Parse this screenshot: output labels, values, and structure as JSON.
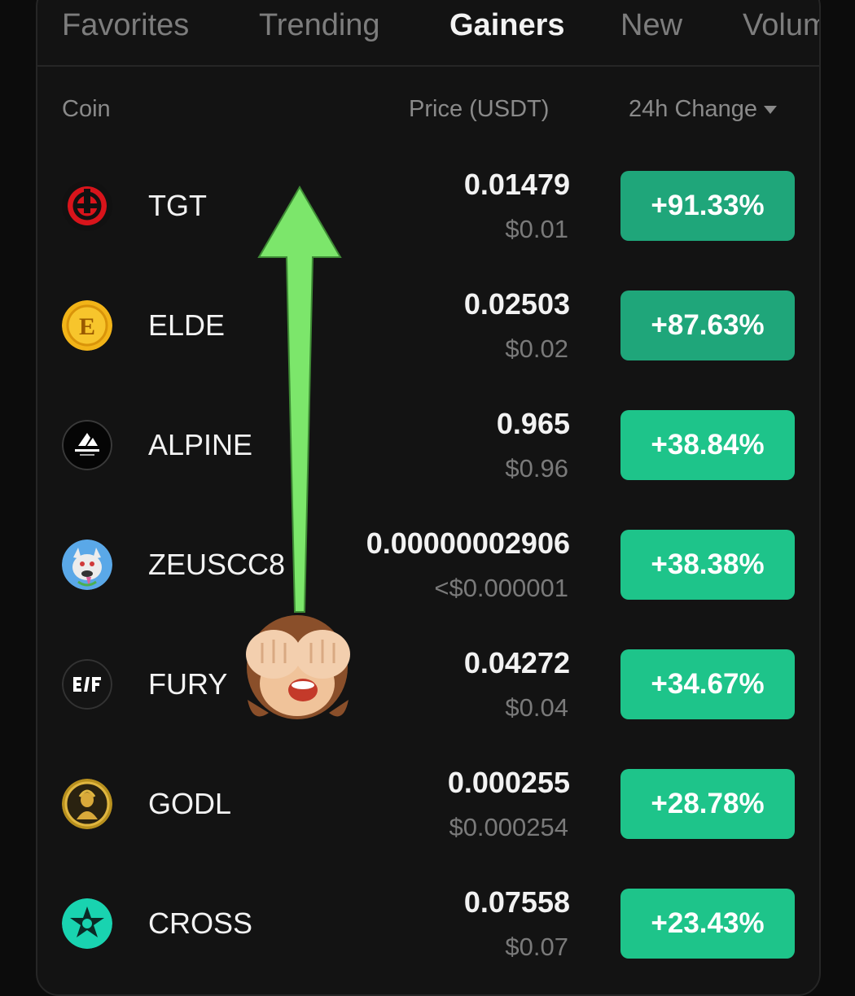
{
  "tabs": [
    {
      "label": "Favorites",
      "active": false
    },
    {
      "label": "Trending",
      "active": false
    },
    {
      "label": "Gainers",
      "active": true
    },
    {
      "label": "New",
      "active": false
    },
    {
      "label": "Volume",
      "active": false
    }
  ],
  "columns": {
    "coin": "Coin",
    "price": "Price (USDT)",
    "change": "24h Change"
  },
  "colors": {
    "up_strong": "#1fa67a",
    "up": "#1ec48a",
    "arrow": "#7ce66b"
  },
  "rows": [
    {
      "symbol": "TGT",
      "price": "0.01479",
      "usd": "$0.01",
      "change": "+91.33%",
      "icon": "tgt-coin-icon"
    },
    {
      "symbol": "ELDE",
      "price": "0.02503",
      "usd": "$0.02",
      "change": "+87.63%",
      "icon": "elde-coin-icon"
    },
    {
      "symbol": "ALPINE",
      "price": "0.965",
      "usd": "$0.96",
      "change": "+38.84%",
      "icon": "alpine-coin-icon"
    },
    {
      "symbol": "ZEUSCC8",
      "price": "0.00000002906",
      "usd": "<$0.000001",
      "change": "+38.38%",
      "icon": "zeus-coin-icon"
    },
    {
      "symbol": "FURY",
      "price": "0.04272",
      "usd": "$0.04",
      "change": "+34.67%",
      "icon": "fury-coin-icon"
    },
    {
      "symbol": "GODL",
      "price": "0.000255",
      "usd": "$0.000254",
      "change": "+28.78%",
      "icon": "godl-coin-icon"
    },
    {
      "symbol": "CROSS",
      "price": "0.07558",
      "usd": "$0.07",
      "change": "+23.43%",
      "icon": "cross-coin-icon"
    }
  ],
  "overlay": {
    "arrow_icon": "up-arrow-annotation",
    "emoji_icon": "see-no-evil-monkey-emoji"
  }
}
